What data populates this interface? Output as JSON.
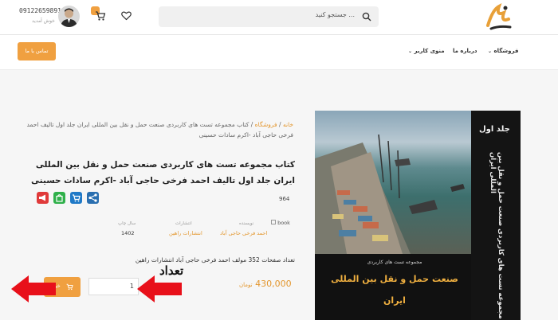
{
  "header": {
    "phone": "09122659891",
    "welcome": "خوش آمدید",
    "search_placeholder": "... جستجو کنید"
  },
  "nav": {
    "items": [
      {
        "label": "فروشگاه",
        "has_dropdown": true
      },
      {
        "label": "درباره ما",
        "has_dropdown": false
      },
      {
        "label": "منوی کاربر",
        "has_dropdown": true
      }
    ],
    "contact_button": "تماس با ما"
  },
  "breadcrumb": {
    "home": "خانه",
    "separator": "/",
    "shop": "فروشگاه",
    "current": "کتاب مجموعه تست های کاربردی صنعت حمل و نقل بین المللی ایران جلد اول تالیف احمد فرخی حاجی آباد -اکرم سادات حسینی"
  },
  "product": {
    "title": "کتاب مجموعه تست های کاربردی صنعت حمل و نقل بین المللی ایران جلد اول تالیف احمد فرخی حاجی آباد -اکرم سادات حسینی",
    "code": "964",
    "image_alt": "book",
    "meta": {
      "author_label": "نویسنده",
      "author_value": "احمد فرخی حاجی آباد",
      "publisher_label": "انتشارات",
      "publisher_value": "انتشارات راهین",
      "year_label": "سال چاپ",
      "year_value": "1402"
    },
    "description": "تعداد صفحات 352 مولف احمد فرخی حاجی آباد انتشارات راهین",
    "price": "430,000",
    "price_unit": "تومان",
    "quantity": "1",
    "buy_label": "خرید"
  },
  "annotation": {
    "label": "تعداد"
  },
  "book_cover": {
    "volume": "جلد اول",
    "spine_title": "مجموعه تست های کاربردی صنعت حمل و نقل بین المللی ایران",
    "subtitle": "مجموعه تست های کاربردی",
    "title_line1": "صنعت حمل و نقل بین المللی",
    "title_line2": "ایران"
  },
  "colors": {
    "accent": "#f0a040",
    "link": "#e3962d",
    "annotation_arrow": "#e8101a"
  }
}
